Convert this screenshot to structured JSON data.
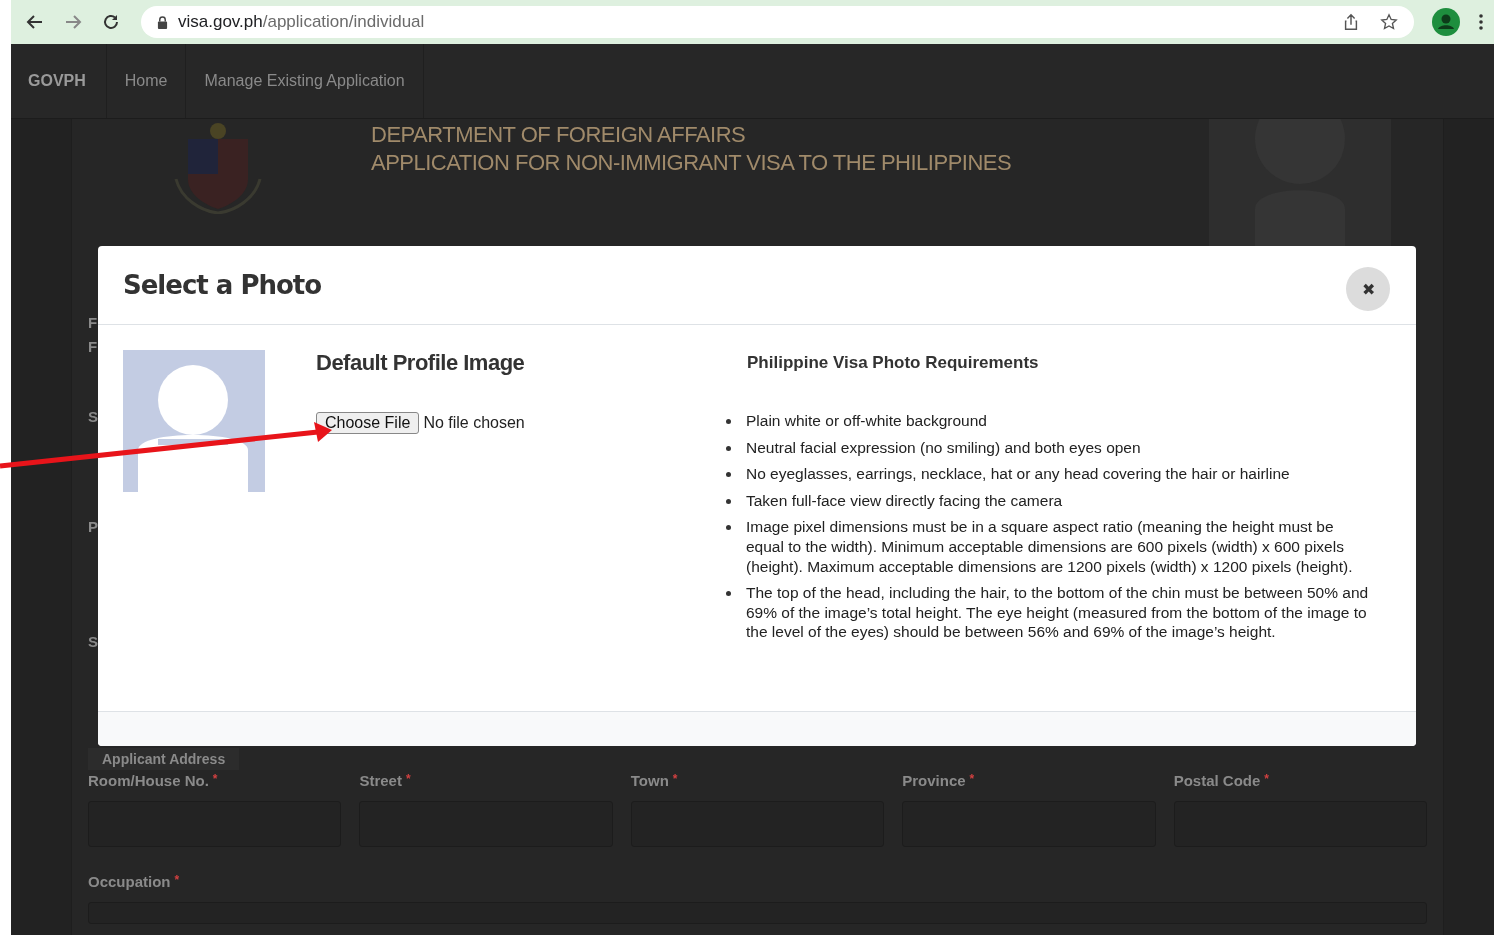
{
  "browser": {
    "url_host": "visa.gov.ph",
    "url_path": "/application/individual"
  },
  "navbar": {
    "brand": "GOVPH",
    "links": [
      "Home",
      "Manage Existing Application"
    ]
  },
  "header": {
    "lines": [
      "DEPARTMENT OF FOREIGN AFFAIRS",
      "APPLICATION FOR NON-IMMIGRANT VISA TO THE PHILIPPINES"
    ]
  },
  "form": {
    "cut_labels": [
      "F",
      "F",
      "S",
      "P",
      "S"
    ],
    "section_tab": "Applicant Address",
    "address_fields": [
      {
        "label": "Room/House No.",
        "mark": "*"
      },
      {
        "label": "Street",
        "mark": "*"
      },
      {
        "label": "Town",
        "mark": "*"
      },
      {
        "label": "Province",
        "mark": "*"
      },
      {
        "label": "Postal Code",
        "mark": "*"
      }
    ],
    "occupation": {
      "label": "Occupation",
      "mark": "*"
    }
  },
  "modal": {
    "title": "Select a Photo",
    "close": "✖",
    "image_title": "Default Profile Image",
    "file_button": "Choose File",
    "file_status": "No file chosen",
    "requirements_title": "Philippine Visa Photo Requirements",
    "requirements": [
      "Plain white or off-white background",
      "Neutral facial expression (no smiling) and both eyes open",
      "No eyeglasses, earrings, necklace, hat or any head covering the hair or hairline",
      "Taken full-face view directly facing the camera",
      "Image pixel dimensions must be in a square aspect ratio (meaning the height must be equal to the width). Minimum acceptable dimensions are 600 pixels (width) x 600 pixels (height). Maximum acceptable dimensions are 1200 pixels (width) x 1200 pixels (height).",
      "The top of the head, including the hair, to the bottom of the chin must be between 50% and 69% of the image’s total height. The eye height (measured from the bottom of the image to the level of the eyes) should be between 56% and 69% of the image’s height."
    ]
  }
}
